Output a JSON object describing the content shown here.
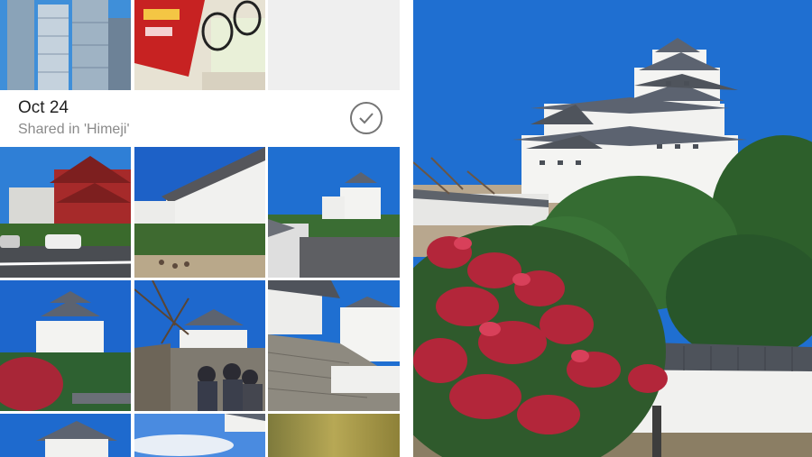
{
  "section": {
    "date": "Oct 24",
    "subtitle": "Shared in 'Himeji'",
    "select_icon": "check-circle-icon"
  },
  "colors": {
    "sky": "#1f6fd1",
    "castle_white": "#f4f4f2",
    "roof_gray": "#5c6370",
    "foliage": "#2f6b35",
    "red_leaves": "#b3263a"
  },
  "photos": {
    "top_row": [
      "Skyscraper photo",
      "Pocky snack photo"
    ],
    "grid_count": 9,
    "preview": "Himeji Castle photo"
  }
}
